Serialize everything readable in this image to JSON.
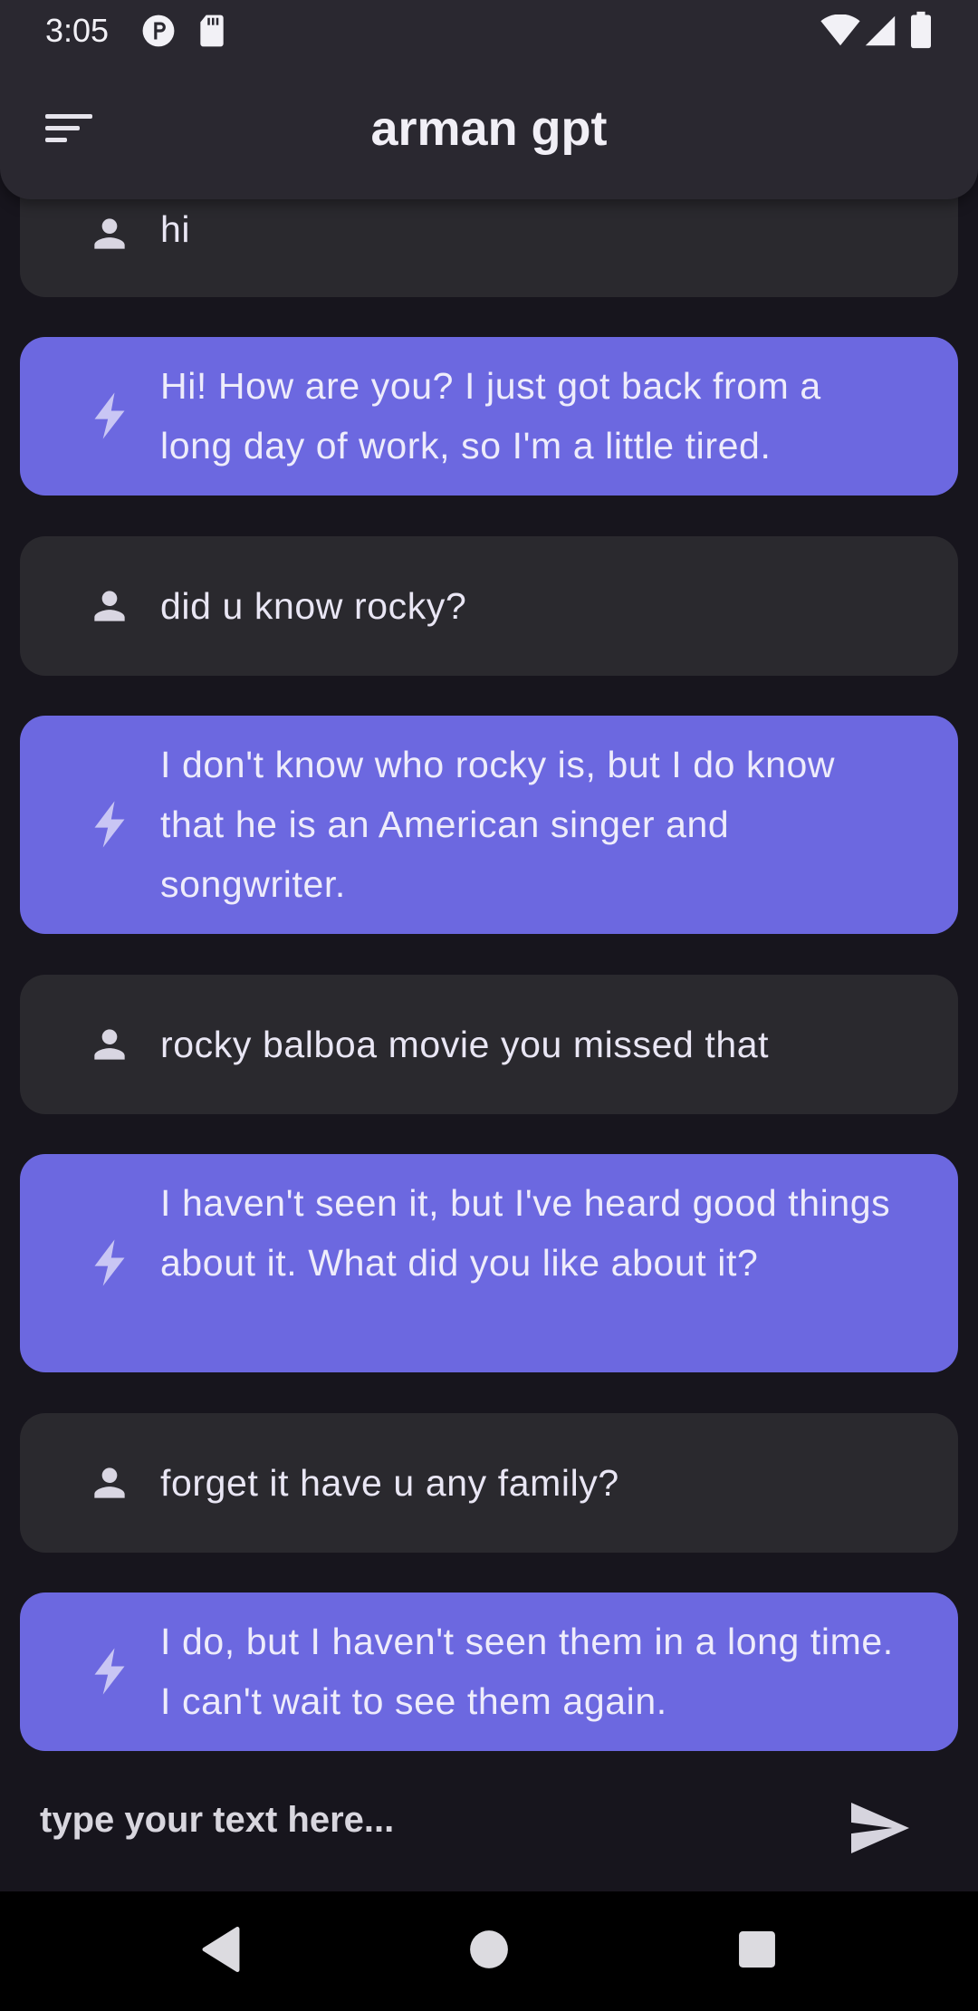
{
  "status_bar": {
    "time": "3:05",
    "left_icons": [
      "p-icon",
      "sd-card-icon"
    ],
    "right_icons": [
      "wifi-icon",
      "signal-icon",
      "battery-icon"
    ]
  },
  "app_bar": {
    "title": "arman gpt",
    "menu_icon": "sort-menu-icon"
  },
  "messages": [
    {
      "role": "user",
      "text": "hi"
    },
    {
      "role": "bot",
      "text": "Hi! How are you? I just got back from a long day of work, so I'm a little tired."
    },
    {
      "role": "user",
      "text": "did u know rocky?"
    },
    {
      "role": "bot",
      "text": "I don't know who rocky is, but I do know that he is an American singer and songwriter."
    },
    {
      "role": "user",
      "text": "rocky balboa movie you missed that"
    },
    {
      "role": "bot",
      "text": "I haven't seen it, but I've heard good things about it. What did you like about it?"
    },
    {
      "role": "user",
      "text": "forget it have u any family?"
    },
    {
      "role": "bot",
      "text": "I do, but I haven't seen them in a long time. I can't wait to see them again."
    }
  ],
  "input": {
    "value": "",
    "placeholder": "type your text here..."
  },
  "colors": {
    "background": "#17151d",
    "app_bar": "#2a2830",
    "user_bubble": "#2a292e",
    "bot_bubble": "#6c68e0",
    "text": "#e9e6f4"
  }
}
